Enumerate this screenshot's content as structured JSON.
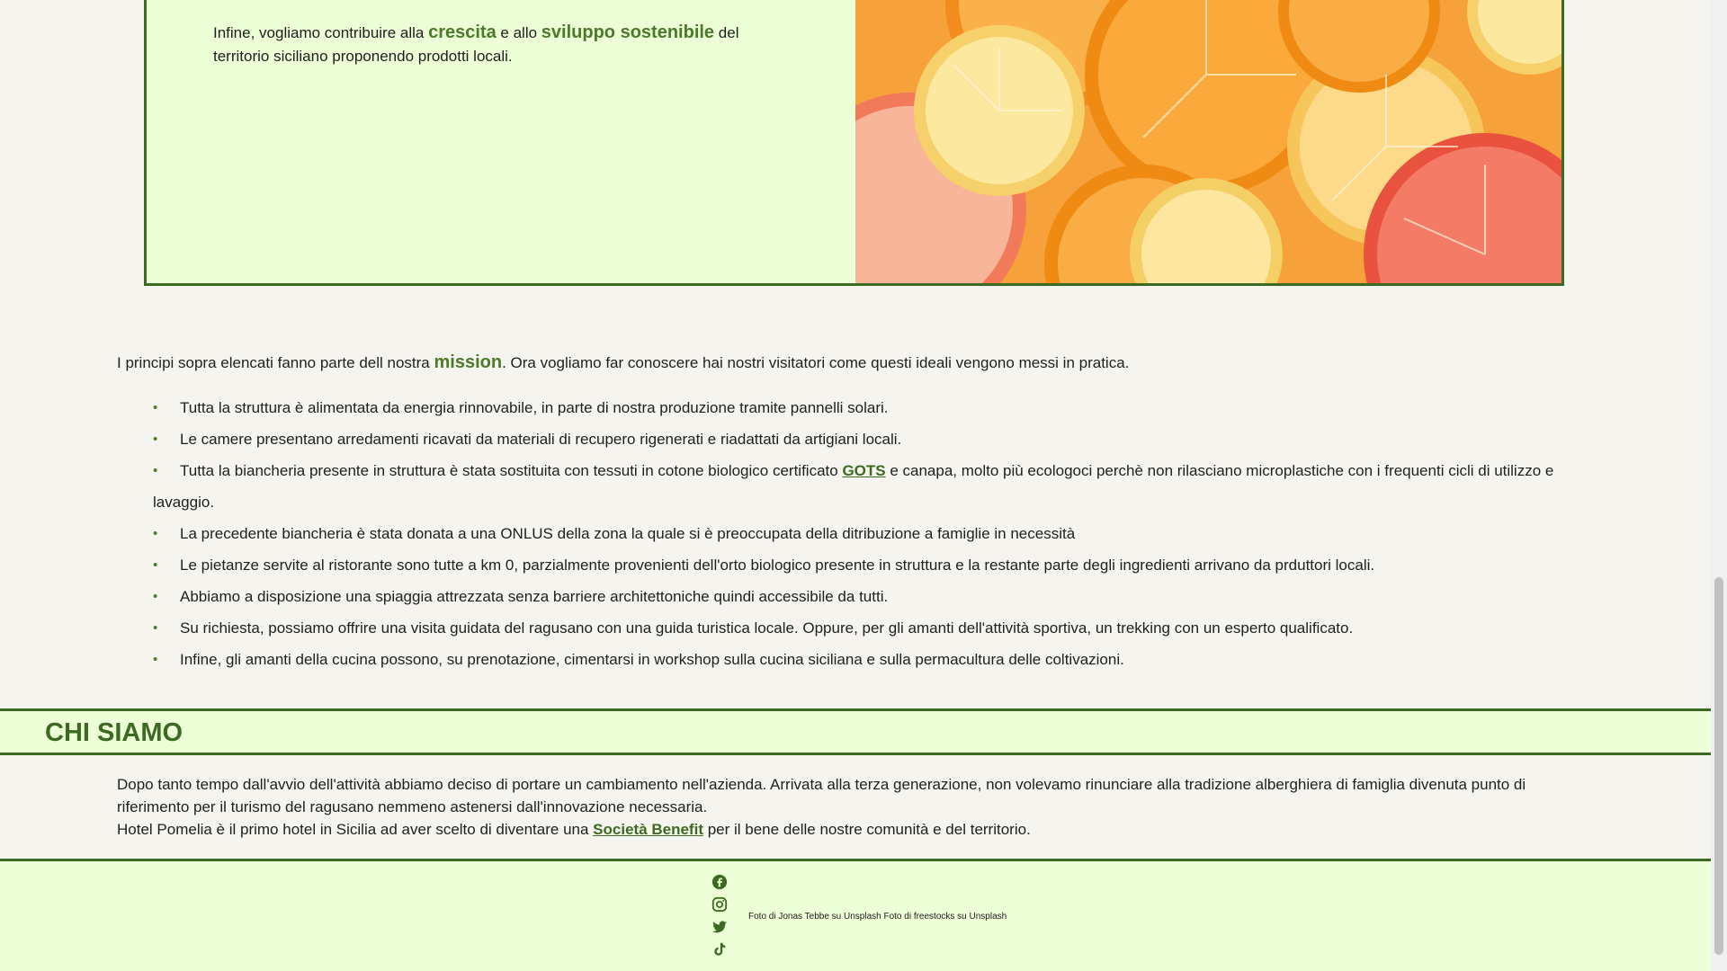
{
  "card": {
    "p1": "Infine, vogliamo contribuire alla ",
    "h1": "crescita",
    "p2": " e allo ",
    "h2": "sviluppo sostenibile",
    "p3": " del territorio siciliano proponendo prodotti locali."
  },
  "mission": {
    "before": "I principi sopra elencati fanno parte dell nostra ",
    "highlight": "mission",
    "after": ". Ora vogliamo far conoscere hai nostri visitatori come questi ideali vengono messi in pratica."
  },
  "features": [
    "Tutta la struttura è alimentata da energia rinnovabile, in parte di nostra produzione tramite pannelli solari.",
    "Le camere presentano arredamenti ricavati da materiali di recupero rigenerati e riadattati da artigiani locali.",
    "La precedente biancheria è stata donata a una ONLUS della zona la quale si è preoccupata della ditribuzione a famiglie in necessità",
    "Le pietanze servite al ristorante sono tutte a km 0, parzialmente provenienti dell'orto biologico presente in struttura e la restante parte degli ingredienti arrivano da prduttori locali.",
    "Abbiamo a disposizione una spiaggia attrezzata senza barriere architettoniche quindi accessibile da tutti.",
    "Su richiesta, possiamo offrire una visita guidata del ragusano con una guida turistica locale. Oppure, per gli amanti dell'attività sportiva, un trekking con un esperto qualificato.",
    "Infine, gli amanti della cucina possono, su prenotazione, cimentarsi in workshop sulla cucina siciliana e sulla permacultura delle coltivazioni."
  ],
  "gots_item": {
    "before": "Tutta la biancheria presente in struttura è stata sostituita con tessuti in cotone biologico certificato ",
    "link": "GOTS",
    "after": " e canapa, molto più ecologoci perchè non rilasciano microplastiche con i frequenti cicli di utilizzo e lavaggio."
  },
  "chi_siamo": {
    "title": "CHI SIAMO",
    "line1": "Dopo tanto tempo dall'avvio dell'attività abbiamo deciso di portare un cambiamento nell'azienda. Arrivata alla terza generazione, non volevamo rinunciare alla tradizione alberghiera di famiglia divenuta punto di riferimento per il turismo del ragusano nemmeno astenersi dall'innovazione necessaria.",
    "line2_before": "Hotel Pomelia è il primo hotel in Sicilia ad aver scelto di diventare una ",
    "line2_link": "Società Benefit",
    "line2_after": " per il bene delle nostre comunità e del territorio."
  },
  "footer": {
    "socials": [
      "facebook-icon",
      "instagram-icon",
      "twitter-icon",
      "tiktok-icon"
    ],
    "credits": "Foto di Jonas Tebbe su Unsplash Foto di freestocks su Unsplash"
  },
  "colors": {
    "accent": "#3d6a22",
    "panel": "#ecffd6",
    "background": "#f6f4ee"
  }
}
